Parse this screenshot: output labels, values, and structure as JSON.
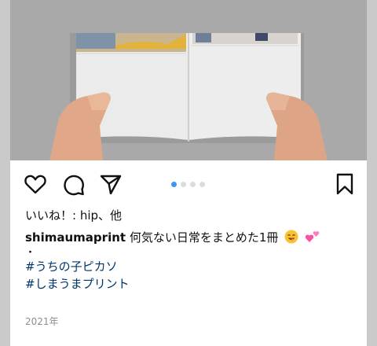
{
  "post": {
    "image_dots": {
      "total": 4,
      "active_index": 0
    },
    "likes_text": "いいね！: hip、他",
    "caption": {
      "username": "shimaumaprint",
      "text": "何気ない日常をまとめた1冊",
      "emojis": [
        "smiling-face-emoji",
        "two-hearts-emoji"
      ]
    },
    "bullet": "・",
    "hashtags": [
      "#うちの子ピカソ",
      "#しまうまプリント"
    ],
    "date": "2021年"
  },
  "colors": {
    "accent_dot": "#3897f0",
    "hashtag": "#003569",
    "muted": "#8e8e8e"
  }
}
